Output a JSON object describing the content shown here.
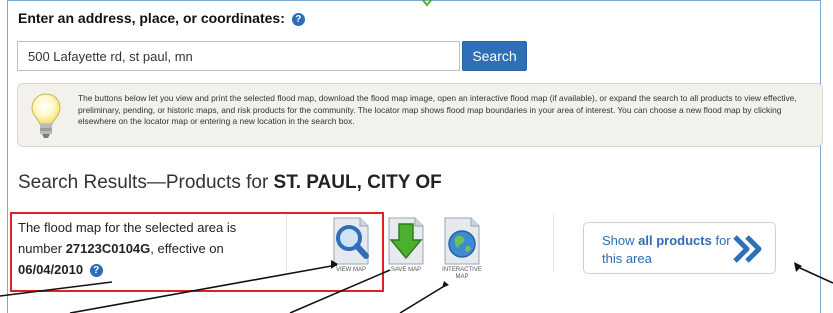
{
  "search": {
    "label": "Enter an address, place, or coordinates:",
    "value": "500 Lafayette rd, st paul, mn",
    "button_label": "Search"
  },
  "info": {
    "text": "The buttons below let you view and print the selected flood map, download the flood map image, open an interactive flood map (if available), or expand the search to all products to view effective, preliminary, pending, or historic maps, and risk products for the community. The locator map shows flood map boundaries in your area of interest. You can choose a new flood map by clicking elsewhere on the locator map or entering a new location in the search box."
  },
  "results": {
    "heading_prefix": "Search Results—Products for",
    "place": "ST. PAUL, CITY OF"
  },
  "flood_map": {
    "text_before": "The flood map for the selected area is number",
    "panel_number": "27123C0104G",
    "text_mid": ", effective on",
    "effective_date": "06/04/2010"
  },
  "tools": {
    "view_map": "VIEW MAP",
    "save_map": "SAVE MAP",
    "interactive_map": "INTERACTIVE MAP"
  },
  "show_all": {
    "prefix": "Show",
    "bold": "all products",
    "suffix": "for this area"
  },
  "colors": {
    "accent_blue": "#2f6fb8",
    "highlight_red": "#e41e26",
    "save_green": "#4caf2f"
  }
}
